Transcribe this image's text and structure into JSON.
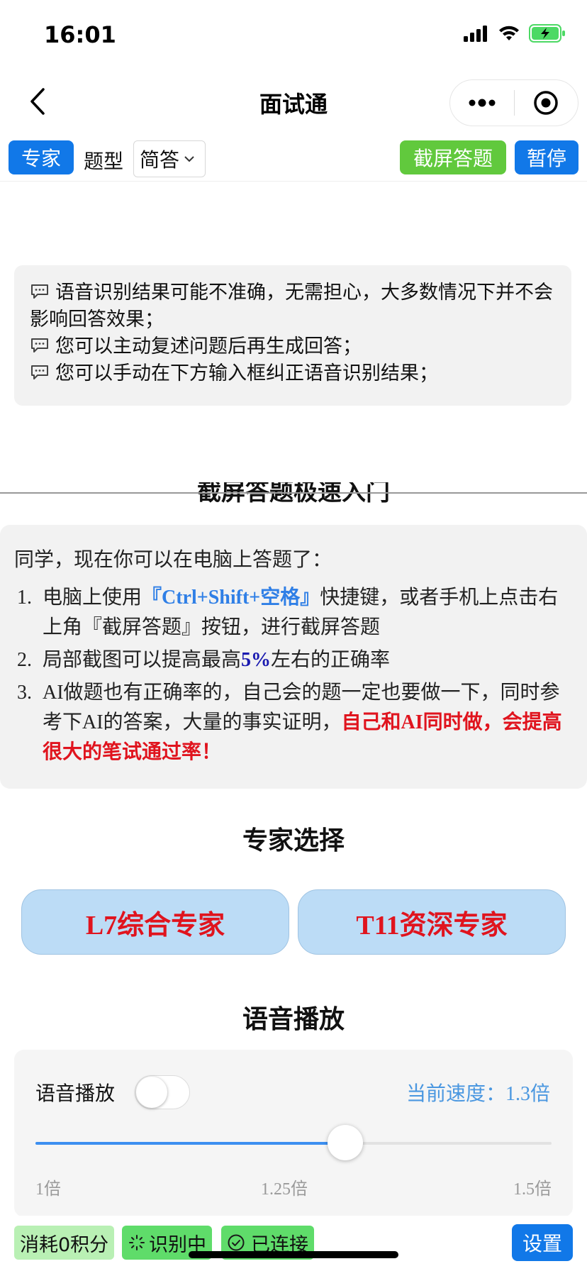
{
  "status_bar": {
    "time": "16:01",
    "battery_color": "#4cd964"
  },
  "nav": {
    "title": "面试通",
    "back_icon": "chevron-left-icon",
    "more_icon": "more-dots-icon",
    "record_icon": "target-circle-icon"
  },
  "toolbar": {
    "expert_label": "专家",
    "type_label": "题型",
    "type_value": "简答",
    "screenshot_label": "截屏答题",
    "pause_label": "暂停"
  },
  "tips": [
    "语音识别结果可能不准确，无需担心，大多数情况下并不会影响回答效果；",
    "您可以主动复述问题后再生成回答；",
    "您可以手动在下方输入框纠正语音识别结果；"
  ],
  "cut_heading": "截屏答题极速入门",
  "guide": {
    "intro": "同学，现在你可以在电脑上答题了：",
    "items": [
      {
        "num": "1.",
        "pre": "电脑上使用",
        "kw": "『Ctrl+Shift+空格』",
        "post": "快捷键，或者手机上点击右上角『截屏答题』按钮，进行截屏答题"
      },
      {
        "num": "2.",
        "pre": "局部截图可以提高最高",
        "kw": "5%",
        "post": "左右的正确率"
      },
      {
        "num": "3.",
        "pre": "AI做题也有正确率的，自己会的题一定也要做一下，同时参考下AI的答案，大量的事实证明，",
        "kw": "自己和AI同时做，会提高很大的笔试通过率！",
        "post": ""
      }
    ]
  },
  "expert_section": {
    "title": "专家选择",
    "options": [
      "L7综合专家",
      "T11资深专家"
    ]
  },
  "voice_section": {
    "title": "语音播放",
    "toggle_label": "语音播放",
    "toggle_on": false,
    "speed_text": "当前速度：1.3倍",
    "slider_min": 1,
    "slider_max": 1.5,
    "slider_value": 1.3,
    "ticks": [
      "1倍",
      "1.25倍",
      "1.5倍"
    ]
  },
  "bottom": {
    "points": "消耗0积分",
    "recognizing": "识别中",
    "connected": "已连接",
    "settings": "设置"
  }
}
